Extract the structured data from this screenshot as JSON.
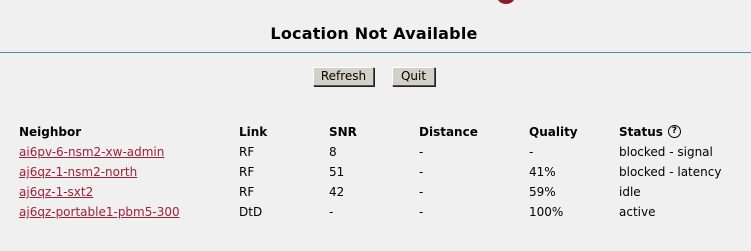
{
  "header": {
    "title": "Location Not Available"
  },
  "controls": {
    "refresh_label": "Refresh",
    "quit_label": "Quit"
  },
  "table": {
    "headers": {
      "neighbor": "Neighbor",
      "link": "Link",
      "snr": "SNR",
      "distance": "Distance",
      "quality": "Quality",
      "status": "Status"
    },
    "help_icon": "question-circle-icon",
    "rows": [
      {
        "neighbor": "ai6pv-6-nsm2-xw-admin",
        "link": "RF",
        "snr": "8",
        "distance": "-",
        "quality": "-",
        "status": "blocked - signal"
      },
      {
        "neighbor": "aj6qz-1-nsm2-north",
        "link": "RF",
        "snr": "51",
        "distance": "-",
        "quality": "41%",
        "status": "blocked - latency"
      },
      {
        "neighbor": "aj6qz-1-sxt2",
        "link": "RF",
        "snr": "42",
        "distance": "-",
        "quality": "59%",
        "status": "idle"
      },
      {
        "neighbor": "aj6qz-portable1-pbm5-300",
        "link": "DtD",
        "snr": "-",
        "distance": "-",
        "quality": "100%",
        "status": "active"
      }
    ]
  },
  "colors": {
    "background": "#f0f0f0",
    "divider": "#4d8fa3",
    "link": "#a0213a",
    "logo_accent": "#8b1a2b"
  }
}
